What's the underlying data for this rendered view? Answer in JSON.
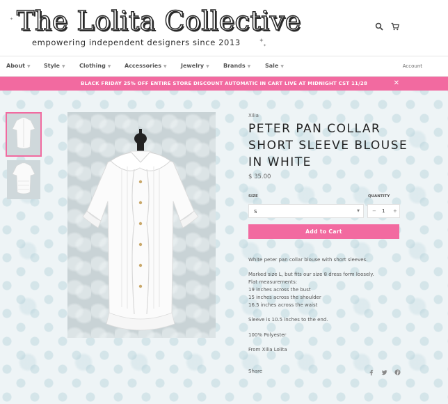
{
  "header": {
    "logo_title": "The Lolita Collective",
    "logo_tagline": "empowering independent designers since 2013",
    "search_icon": "search-icon",
    "cart_icon": "cart-icon"
  },
  "nav": {
    "items": [
      {
        "label": "About"
      },
      {
        "label": "Style"
      },
      {
        "label": "Clothing"
      },
      {
        "label": "Accessories"
      },
      {
        "label": "Jewelry"
      },
      {
        "label": "Brands"
      },
      {
        "label": "Sale"
      }
    ],
    "account_label": "Account"
  },
  "banner": {
    "text": "BLACK FRIDAY 25% OFF ENTIRE STORE DISCOUNT AUTOMATIC IN CART LIVE AT MIDNIGHT CST 11/28",
    "close_label": "Close",
    "color": "#f26aa0"
  },
  "product": {
    "vendor": "Xilia",
    "title": "PETER PAN COLLAR SHORT SLEEVE BLOUSE IN WHITE",
    "price": "$ 35.00",
    "size_label": "SIZE",
    "size_value": "S",
    "quantity_label": "QUANTITY",
    "quantity_value": "1",
    "minus": "−",
    "plus": "+",
    "add_to_cart": "Add to Cart",
    "description": [
      "White peter pan collar blouse with short sleeves.",
      "Marked size L, but fits our size 8 dress form loosely.",
      "Flat measurements:",
      "19 inches across the bust",
      "15 inches across the shoulder",
      "16.5 inches across the waist",
      "Sleeve is 10.5 inches to the end.",
      "100% Polyester",
      "From Xilia Lolita"
    ],
    "share_label": "Share",
    "share_icons": [
      "facebook-icon",
      "twitter-icon",
      "pinterest-icon"
    ]
  }
}
